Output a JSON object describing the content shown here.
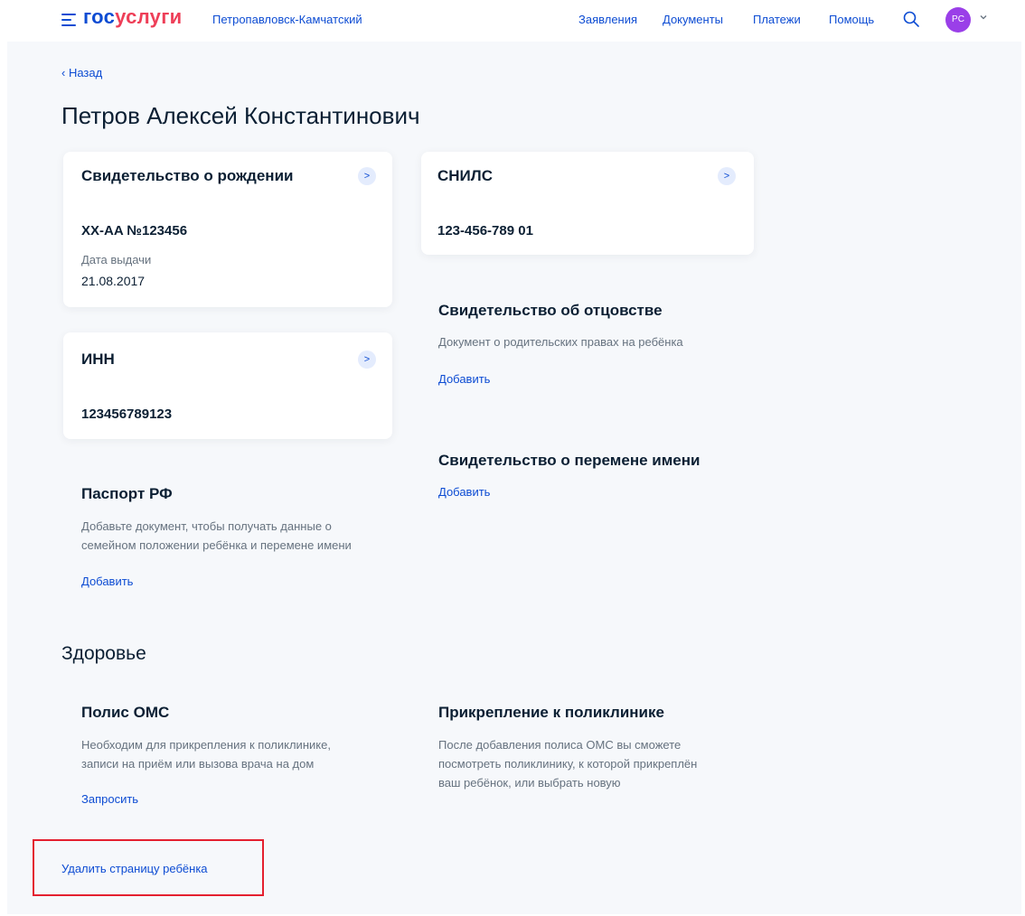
{
  "header": {
    "logo_part1": "гос",
    "logo_part2": "услуги",
    "city": "Петропавловск-Камчатский",
    "nav": [
      "Заявления",
      "Документы",
      "Платежи",
      "Помощь"
    ],
    "avatar_initials": "PC",
    "brand_color": "#0d4cd3",
    "logo_accent_color": "#ee3f58",
    "avatar_color": "#9a3fe8"
  },
  "back_label": "Назад",
  "page_title": "Петров Алексей Константинович",
  "documents": {
    "birth_certificate": {
      "title": "Свидетельство о рождении",
      "number": "XX-AA №123456",
      "date_label": "Дата выдачи",
      "date": "21.08.2017"
    },
    "snils": {
      "title": "СНИЛС",
      "number": "123-456-789 01"
    },
    "inn": {
      "title": "ИНН",
      "number": "123456789123"
    },
    "paternity": {
      "title": "Свидетельство об отцовстве",
      "desc": "Документ о родительских правах на ребёнка",
      "action": "Добавить"
    },
    "name_change": {
      "title": "Свидетельство о перемене имени",
      "action": "Добавить"
    },
    "passport": {
      "title": "Паспорт РФ",
      "desc_line1": "Добавьте документ, чтобы получать данные о",
      "desc_line2": "семейном положении ребёнка и перемене имени",
      "action": "Добавить"
    }
  },
  "health": {
    "section_title": "Здоровье",
    "oms": {
      "title": "Полис ОМС",
      "desc_line1": "Необходим для прикрепления к поликлинике,",
      "desc_line2": "записи на приём или вызова врача на дом",
      "action": "Запросить"
    },
    "clinic": {
      "title": "Прикрепление к поликлинике",
      "desc_line1": "После добавления полиса ОМС вы сможете",
      "desc_line2": "посмотреть поликлинику, к которой прикреплён",
      "desc_line3": "ваш ребёнок, или выбрать новую"
    }
  },
  "delete_link": "Удалить страницу ребёнка",
  "highlight_color": "#e4202f"
}
